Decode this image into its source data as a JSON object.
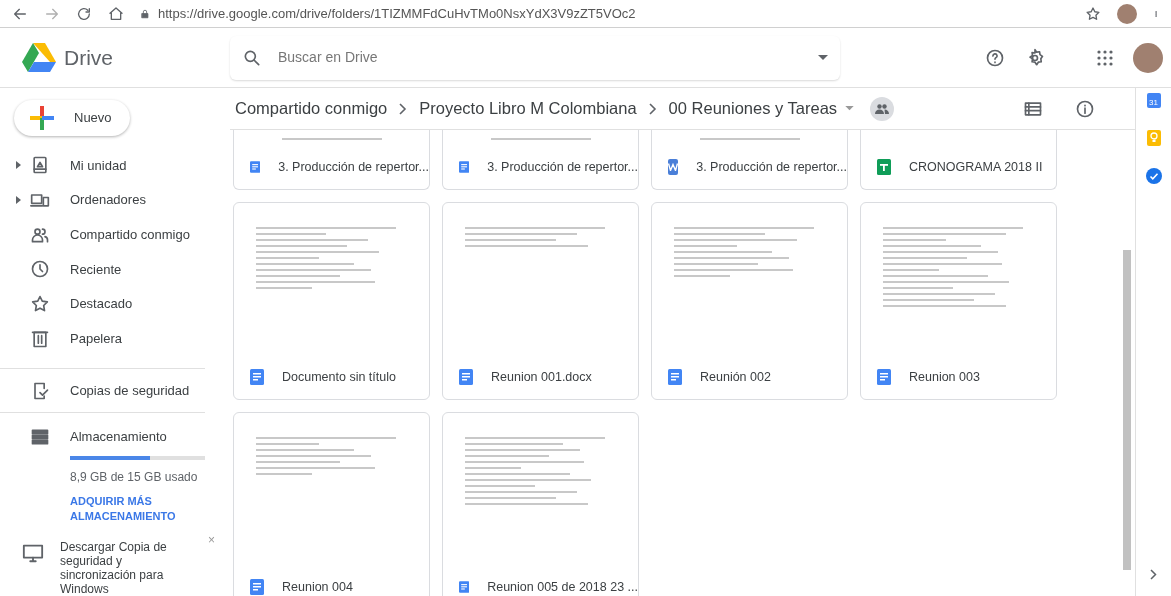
{
  "browser": {
    "url": "https://drive.google.com/drive/folders/1TIZMMFdCuHvTMo0NsxYdX3V9zZT5VOc2"
  },
  "header": {
    "app_name": "Drive",
    "search": {
      "placeholder": "Buscar en Drive"
    }
  },
  "sidebar": {
    "new_button": "Nuevo",
    "items": [
      {
        "label": "Mi unidad",
        "expandable": true
      },
      {
        "label": "Ordenadores",
        "expandable": true
      },
      {
        "label": "Compartido conmigo",
        "expandable": false
      },
      {
        "label": "Reciente",
        "expandable": false
      },
      {
        "label": "Destacado",
        "expandable": false
      },
      {
        "label": "Papelera",
        "expandable": false
      }
    ],
    "backup": "Copias de seguridad",
    "storage": {
      "label": "Almacenamiento",
      "level": 0.59,
      "usage": "8,9 GB de 15 GB usado",
      "link": "ADQUIRIR MÁS ALMACENAMIENTO"
    },
    "promo": {
      "text": "Descargar Copia de seguridad y sincronización para Windows",
      "close": "×"
    }
  },
  "breadcrumb": [
    {
      "label": "Compartido conmigo"
    },
    {
      "label": "Proyecto Libro M Colombiana"
    },
    {
      "label": "00 Reuniones y Tareas"
    }
  ],
  "right_panel": {
    "calendar_day": "31"
  },
  "files": [
    {
      "name": "3. Producción de repertor...",
      "kind": "doc"
    },
    {
      "name": "3. Producción de repertor...",
      "kind": "doc"
    },
    {
      "name": "3. Producción de repertor...",
      "kind": "word"
    },
    {
      "name": "CRONOGRAMA 2018 II",
      "kind": "sheet"
    },
    {
      "name": "Documento sin título",
      "kind": "doc"
    },
    {
      "name": "Reunion 001.docx",
      "kind": "doc"
    },
    {
      "name": "Reunión 002",
      "kind": "doc"
    },
    {
      "name": "Reunion 003",
      "kind": "doc"
    },
    {
      "name": "Reunion 004",
      "kind": "doc"
    },
    {
      "name": "Reunion 005 de 2018 23 ...",
      "kind": "doc"
    }
  ]
}
